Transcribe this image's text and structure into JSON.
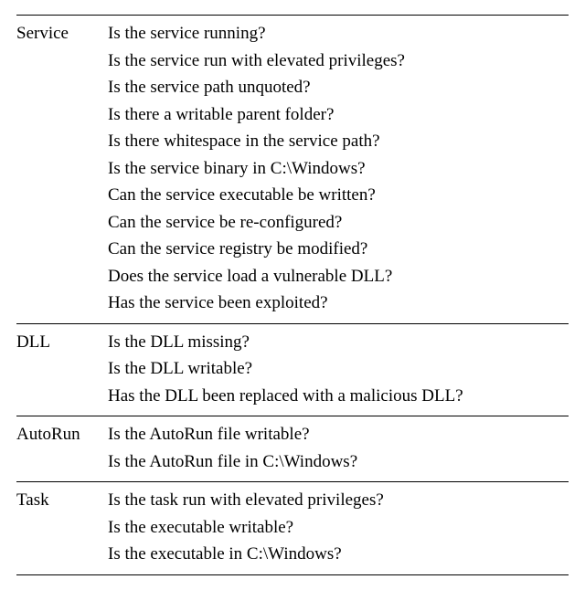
{
  "sections": [
    {
      "category": "Service",
      "questions": [
        "Is the service running?",
        "Is the service run with elevated privileges?",
        "Is the service path unquoted?",
        "Is there a writable parent folder?",
        "Is there whitespace in the service path?",
        "Is the service binary in C:\\Windows?",
        "Can the service executable be written?",
        "Can the service be re-configured?",
        "Can the service registry be modified?",
        "Does the service load a vulnerable DLL?",
        "Has the service been exploited?"
      ]
    },
    {
      "category": "DLL",
      "questions": [
        "Is the DLL missing?",
        "Is the DLL writable?",
        "Has the DLL been replaced with a malicious DLL?"
      ]
    },
    {
      "category": "AutoRun",
      "questions": [
        "Is the AutoRun file writable?",
        "Is the AutoRun file in C:\\Windows?"
      ]
    },
    {
      "category": "Task",
      "questions": [
        "Is the task run with elevated privileges?",
        "Is the executable writable?",
        "Is the executable in C:\\Windows?"
      ]
    }
  ]
}
